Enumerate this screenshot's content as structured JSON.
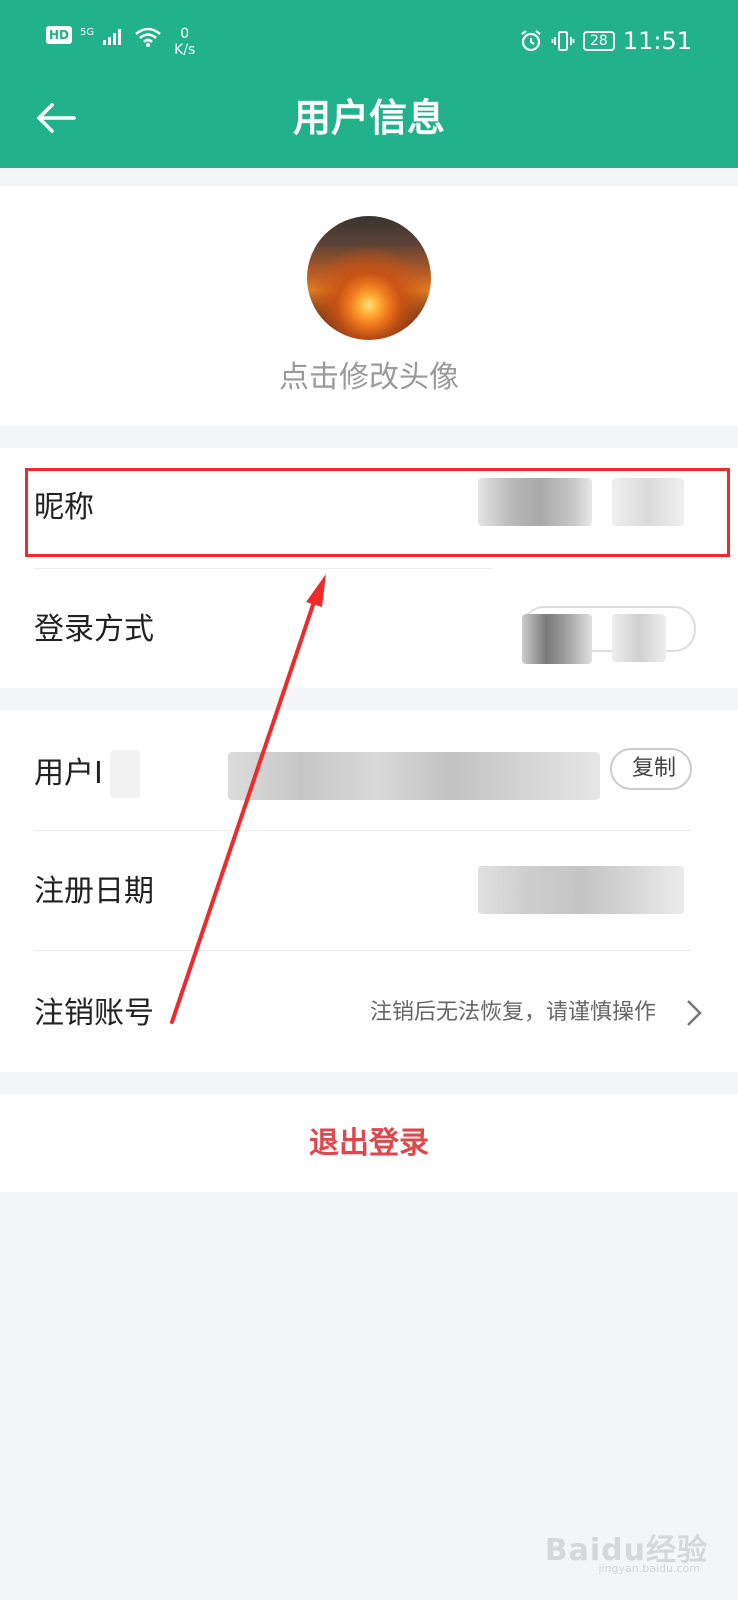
{
  "status_bar": {
    "hd": "HD",
    "net": "5G",
    "net_speed_value": "0",
    "net_speed_unit": "K/s",
    "battery": "28",
    "time": "11:51"
  },
  "header": {
    "title": "用户信息"
  },
  "avatar_section": {
    "caption": "点击修改头像"
  },
  "profile_rows": {
    "nickname_label": "昵称",
    "login_method_label": "登录方式"
  },
  "account_rows": {
    "user_id_label": "用户I",
    "copy_button": "复制",
    "register_date_label": "注册日期",
    "cancel_account_label": "注销账号",
    "cancel_account_hint": "注销后无法恢复，请谨慎操作"
  },
  "logout": {
    "label": "退出登录"
  },
  "watermark": {
    "text": "Baidu经验",
    "sub": "jingyan.baidu.com"
  },
  "colors": {
    "primary": "#21b28b",
    "danger": "#e0474c",
    "annotation": "#ee2a2a"
  }
}
